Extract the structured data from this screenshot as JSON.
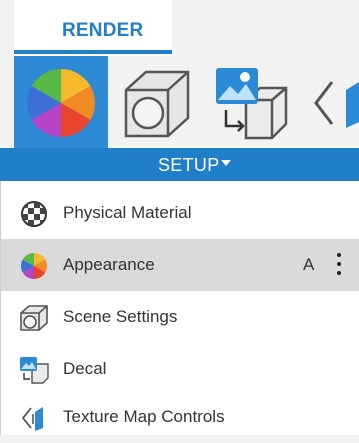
{
  "workspace": {
    "tab_label": "RENDER",
    "accent_color": "#1f7fc9"
  },
  "toolbar": {
    "tools": [
      {
        "name": "appearance-tool",
        "icon": "color-wheel-icon",
        "active": true
      },
      {
        "name": "scene-settings-tool",
        "icon": "scene-settings-icon",
        "active": false
      },
      {
        "name": "decal-tool",
        "icon": "decal-icon",
        "active": false
      },
      {
        "name": "texture-map-tool",
        "icon": "texture-map-icon",
        "active": false
      }
    ],
    "setup_label": "SETUP"
  },
  "menu": {
    "items": [
      {
        "label": "Physical Material",
        "icon": "material-sphere-icon",
        "shortcut": "",
        "highlighted": false
      },
      {
        "label": "Appearance",
        "icon": "color-wheel-icon",
        "shortcut": "A",
        "highlighted": true
      },
      {
        "label": "Scene Settings",
        "icon": "scene-settings-icon",
        "shortcut": "",
        "highlighted": false
      },
      {
        "label": "Decal",
        "icon": "decal-icon",
        "shortcut": "",
        "highlighted": false
      },
      {
        "label": "Texture Map Controls",
        "icon": "texture-map-icon",
        "shortcut": "",
        "highlighted": false
      }
    ]
  }
}
